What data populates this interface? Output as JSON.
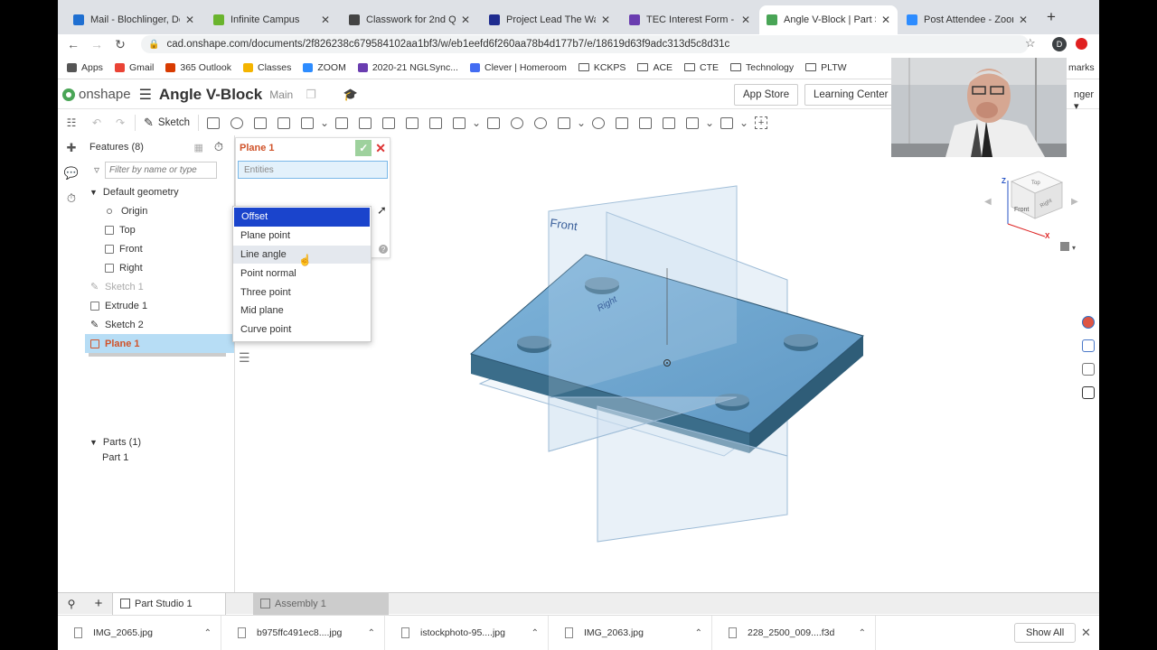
{
  "browser": {
    "tabs": [
      {
        "title": "Mail - Blochlinger, De",
        "color": "#1f6fd1"
      },
      {
        "title": "Infinite Campus",
        "color": "#6ab42d"
      },
      {
        "title": "Classwork for 2nd Qu",
        "color": "#444444"
      },
      {
        "title": "Project Lead The Way",
        "color": "#1f2c8f"
      },
      {
        "title": "TEC Interest Form - F",
        "color": "#6a3db0"
      },
      {
        "title": "Angle V-Block | Part S",
        "color": "#49a556"
      },
      {
        "title": "Post Attendee - Zoom",
        "color": "#2d8cff"
      }
    ],
    "active_tab": 5,
    "url": "cad.onshape.com/documents/2f826238c679584102aa1bf3/w/eb1eefd6f260aa78b4d177b7/e/18619d63f9adc313d5c8d31c",
    "profile_initial": "D",
    "bookmarks": [
      {
        "label": "Apps",
        "kind": "apps"
      },
      {
        "label": "Gmail",
        "kind": "g"
      },
      {
        "label": "365 Outlook",
        "kind": "office"
      },
      {
        "label": "Classes",
        "kind": "classes"
      },
      {
        "label": "ZOOM",
        "kind": "zoom"
      },
      {
        "label": "2020-21 NGLSync...",
        "kind": "ngl"
      },
      {
        "label": "Clever | Homeroom",
        "kind": "clever"
      },
      {
        "label": "KCKPS",
        "kind": "folder"
      },
      {
        "label": "ACE",
        "kind": "folder"
      },
      {
        "label": "CTE",
        "kind": "folder"
      },
      {
        "label": "Technology",
        "kind": "folder"
      },
      {
        "label": "PLTW",
        "kind": "folder"
      }
    ],
    "bookmarks_overflow": "marks"
  },
  "onshape": {
    "brand": "onshape",
    "document_title": "Angle V-Block",
    "branch": "Main",
    "app_store": "App Store",
    "learning_center": "Learning Center",
    "user_fragment": "nger",
    "sketch_label": "Sketch"
  },
  "features": {
    "header": "Features (8)",
    "filter_placeholder": "Filter by name or type",
    "default_geometry": "Default geometry",
    "items": [
      {
        "label": "Origin",
        "indent": 2,
        "state": "normal",
        "icon": "origin"
      },
      {
        "label": "Top",
        "indent": 2,
        "state": "normal",
        "icon": "plane"
      },
      {
        "label": "Front",
        "indent": 2,
        "state": "normal",
        "icon": "plane"
      },
      {
        "label": "Right",
        "indent": 2,
        "state": "normal",
        "icon": "plane"
      },
      {
        "label": "Sketch 1",
        "indent": 1,
        "state": "dim",
        "icon": "sketch"
      },
      {
        "label": "Extrude 1",
        "indent": 1,
        "state": "normal",
        "icon": "extrude"
      },
      {
        "label": "Sketch 2",
        "indent": 1,
        "state": "normal",
        "icon": "sketch"
      },
      {
        "label": "Plane 1",
        "indent": 1,
        "state": "selected",
        "icon": "plane"
      }
    ],
    "parts_header": "Parts (1)",
    "parts": [
      "Part 1"
    ]
  },
  "dialog": {
    "title": "Plane 1",
    "entities_placeholder": "Entities"
  },
  "plane_type_options": {
    "options": [
      "Offset",
      "Plane point",
      "Line angle",
      "Point normal",
      "Three point",
      "Mid plane",
      "Curve point"
    ],
    "selected": 0,
    "hovered": 2
  },
  "viewport": {
    "front_label": "Front",
    "right_label": "Right",
    "viewcube": {
      "top": "Top",
      "front": "Front",
      "right": "Right",
      "z": "Z",
      "x": "X"
    },
    "colors": {
      "plate_top": "#6fa5cf",
      "plate_side": "#3b6d8a",
      "plane": "#cfe1f0",
      "plane_edge": "#9dbbd6"
    }
  },
  "bottom_tabs": {
    "part_studio": "Part Studio 1",
    "assembly": "Assembly 1"
  },
  "downloads": {
    "items": [
      "IMG_2065.jpg",
      "b975ffc491ec8....jpg",
      "istockphoto-95....jpg",
      "IMG_2063.jpg",
      "228_2500_009....f3d"
    ],
    "show_all": "Show All"
  }
}
